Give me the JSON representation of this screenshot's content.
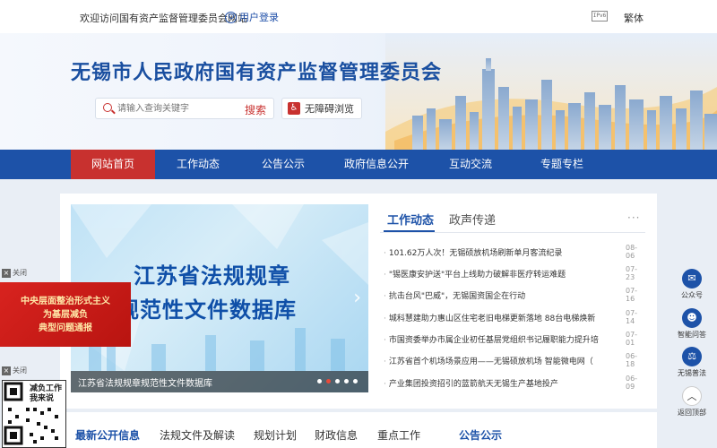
{
  "header": {
    "welcome": "欢迎访问国有资产监督管理委员会网站",
    "login": "用户登录",
    "ipv6": "IPv6",
    "traditional": "繁体"
  },
  "banner": {
    "site_title": "无锡市人民政府国有资产监督管理委员会",
    "search_placeholder": "请输入查询关键字",
    "search_button": "搜索",
    "accessible": "无障碍浏览"
  },
  "nav": {
    "items": [
      "网站首页",
      "工作动态",
      "公告公示",
      "政府信息公开",
      "互动交流",
      "专题专栏"
    ]
  },
  "slider": {
    "title_line1": "江苏省法规规章",
    "title_line2": "规范性文件数据库",
    "caption": "江苏省法规规章规范性文件数据库"
  },
  "news": {
    "tab_active": "工作动态",
    "tab_other": "政声传递",
    "more": "···",
    "items": [
      {
        "title": "101.62万人次！无锡硕放机场刷新单月客流纪录",
        "date": "08-06"
      },
      {
        "title": "\"锡医康安护送\"平台上线助力破解非医疗转运难题",
        "date": "07-23"
      },
      {
        "title": "抗击台风\"巴威\"，无锡国资国企在行动",
        "date": "07-16"
      },
      {
        "title": "城科慧建助力惠山区住宅老旧电梯更新落地 88台电梯焕新",
        "date": "07-14"
      },
      {
        "title": "市国资委举办市属企业初任基层党组织书记履职能力提升培",
        "date": "07-01"
      },
      {
        "title": "江苏省首个机场场景应用——无锡硕放机场 智能微电网（",
        "date": "06-18"
      },
      {
        "title": "产业集团投资招引的蓝箭航天无锡生产基地投产",
        "date": "06-09"
      }
    ]
  },
  "lower_tabs": {
    "items": [
      "最新公开信息",
      "法规文件及解读",
      "规划计划",
      "财政信息",
      "重点工作"
    ],
    "right_tab": "公告公示"
  },
  "sidebar": {
    "items": [
      "公众号",
      "智能问答",
      "无锡普法",
      "返回顶部"
    ]
  },
  "float_ad": {
    "close_label": "关闭",
    "line1": "中央层面整治形式主义",
    "line2": "为基层减负",
    "line3": "典型问题通报",
    "qr_text": "减负工作\n我来说"
  }
}
